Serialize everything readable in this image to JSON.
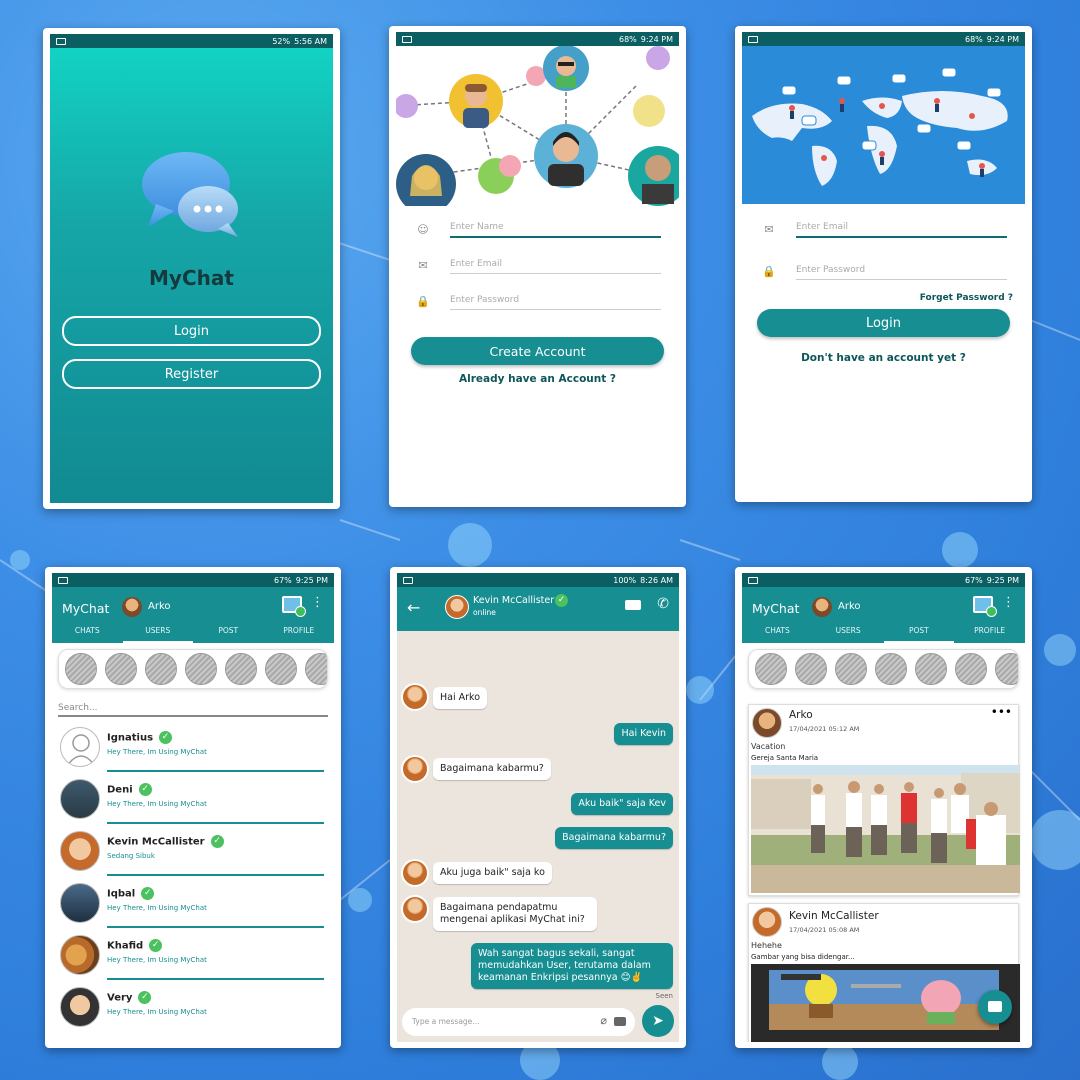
{
  "colors": {
    "teal": "#178e92",
    "dark_teal": "#0b5f62",
    "online": "#4cc15f",
    "bg_blue": "#3d8ee6"
  },
  "s1": {
    "status": {
      "battery": "52%",
      "time": "5:56 AM"
    },
    "app_name": "MyChat",
    "login": "Login",
    "register": "Register",
    "logo_icon": "chat-bubbles-icon"
  },
  "s2": {
    "status": {
      "battery": "68%",
      "time": "9:24 PM"
    },
    "name_ph": "Enter Name",
    "email_ph": "Enter Email",
    "password_ph": "Enter Password",
    "create": "Create Account",
    "already": "Already have an Account ?"
  },
  "s3": {
    "status": {
      "battery": "68%",
      "time": "9:24 PM"
    },
    "email_ph": "Enter Email",
    "password_ph": "Enter Password",
    "forget": "Forget Password ?",
    "login": "Login",
    "noacc": "Don't have an account yet ?"
  },
  "s4": {
    "status": {
      "battery": "67%",
      "time": "9:25 PM"
    },
    "app": "MyChat",
    "user": "Arko",
    "tabs": [
      "CHATS",
      "USERS",
      "POST",
      "PROFILE"
    ],
    "search_ph": "Search...",
    "users": [
      {
        "name": "Ignatius",
        "status": "Hey There, Im Using MyChat"
      },
      {
        "name": "Deni",
        "status": "Hey There, Im Using MyChat"
      },
      {
        "name": "Kevin McCallister",
        "status": "Sedang Sibuk"
      },
      {
        "name": "Iqbal",
        "status": "Hey There, Im Using MyChat"
      },
      {
        "name": "Khafid",
        "status": "Hey There, Im Using MyChat"
      },
      {
        "name": "Very",
        "status": "Hey There, Im Using MyChat"
      }
    ]
  },
  "s5": {
    "status": {
      "battery": "100%",
      "time": "8:26 AM"
    },
    "contact": "Kevin McCallister",
    "presence": "online",
    "messages": [
      {
        "from": "them",
        "text": "Hai Arko"
      },
      {
        "from": "me",
        "text": "Hai Kevin"
      },
      {
        "from": "them",
        "text": "Bagaimana kabarmu?"
      },
      {
        "from": "me",
        "text": "Aku baik\" saja Kev"
      },
      {
        "from": "me",
        "text": "Bagaimana kabarmu?"
      },
      {
        "from": "them",
        "text": "Aku juga baik\" saja ko"
      },
      {
        "from": "them",
        "text": "Bagaimana pendapatmu mengenai aplikasi MyChat ini?"
      },
      {
        "from": "me",
        "text": "Wah sangat bagus sekali, sangat memudahkan User, terutama dalam keamanan Enkripsi pesannya 😊✌️"
      }
    ],
    "seen": "Seen",
    "input_ph": "Type a message..."
  },
  "s6": {
    "status": {
      "battery": "67%",
      "time": "9:25 PM"
    },
    "app": "MyChat",
    "user": "Arko",
    "tabs": [
      "CHATS",
      "USERS",
      "POST",
      "PROFILE"
    ],
    "posts": [
      {
        "author": "Arko",
        "date": "17/04/2021 05:12 AM",
        "title": "Vacation",
        "caption": "Gereja Santa Maria"
      },
      {
        "author": "Kevin McCallister",
        "date": "17/04/2021 05:08 AM",
        "title": "Hehehe",
        "caption": "Gambar yang bisa didengar..."
      }
    ]
  }
}
